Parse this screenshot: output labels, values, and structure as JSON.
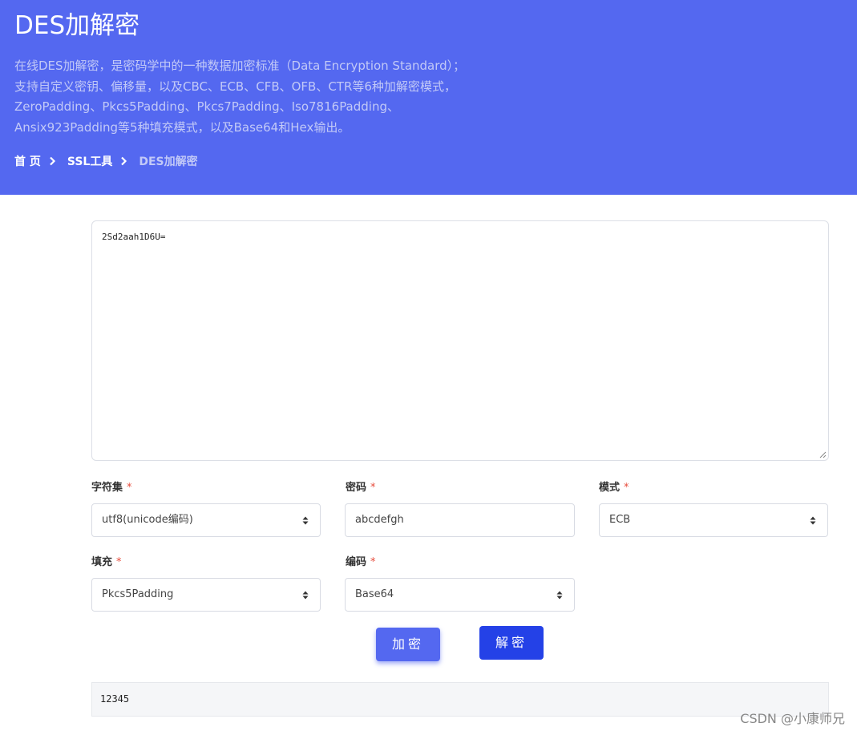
{
  "hero": {
    "title": "DES加解密",
    "description_lines": [
      "在线DES加解密，是密码学中的一种数据加密标准（Data Encryption Standard）；",
      "支持自定义密钥、偏移量，以及CBC、ECB、CFB、OFB、CTR等6种加解密模式，",
      "ZeroPadding、Pkcs5Padding、Pkcs7Padding、Iso7816Padding、",
      "Ansix923Padding等5种填充模式，以及Base64和Hex输出。"
    ],
    "breadcrumb": {
      "home": "首 页",
      "section": "SSL工具",
      "current": "DES加解密"
    }
  },
  "input": {
    "value": "2Sd2aah1D6U="
  },
  "fields": {
    "charset": {
      "label": "字符集",
      "required_mark": "*",
      "value": "utf8(unicode编码)"
    },
    "key": {
      "label": "密码",
      "required_mark": "*",
      "value": "abcdefgh"
    },
    "mode": {
      "label": "模式",
      "required_mark": "*",
      "value": "ECB"
    },
    "padding": {
      "label": "填充",
      "required_mark": "*",
      "value": "Pkcs5Padding"
    },
    "encoding": {
      "label": "编码",
      "required_mark": "*",
      "value": "Base64"
    }
  },
  "buttons": {
    "encrypt": "加密",
    "decrypt": "解密"
  },
  "output": {
    "value": "12345"
  },
  "watermark": "CSDN @小康师兄",
  "colors": {
    "hero_bg": "#5468f0",
    "encrypt_button": "#5468f0",
    "decrypt_button": "#2441e7",
    "required": "#e74c3c"
  },
  "icons": {
    "breadcrumb_separator": "chevron-right-icon",
    "select_arrows": "sort-arrows-icon",
    "textarea_resize": "resize-grip-icon"
  }
}
